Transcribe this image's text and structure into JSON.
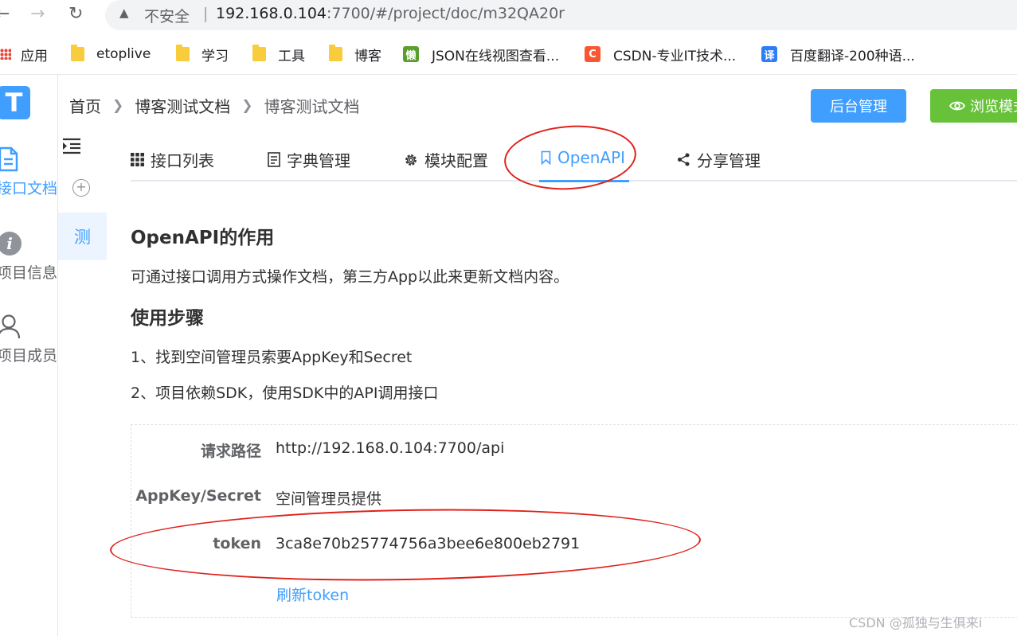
{
  "browser": {
    "security_label": "不安全",
    "url_host": "192.168.0.104",
    "url_rest": ":7700/#/project/doc/m32QA20r",
    "bookmarks": [
      {
        "label": "应用",
        "icon": "apps-grid-icon"
      },
      {
        "label": "etoplive",
        "icon": "folder-icon"
      },
      {
        "label": "学习",
        "icon": "folder-icon"
      },
      {
        "label": "工具",
        "icon": "folder-icon"
      },
      {
        "label": "博客",
        "icon": "folder-icon"
      },
      {
        "label": "JSON在线视图查看...",
        "icon": "lan-icon",
        "glyph": "懒",
        "color": "#5a9e2f"
      },
      {
        "label": "CSDN-专业IT技术...",
        "icon": "csdn-icon",
        "glyph": "C",
        "color": "#fc5531"
      },
      {
        "label": "百度翻译-200种语...",
        "icon": "baidu-translate-icon",
        "glyph": "译",
        "color": "#2d7df6"
      }
    ]
  },
  "sidebar": {
    "logo": "T",
    "items": [
      {
        "label": "接口文档",
        "icon": "document-icon",
        "active": true
      },
      {
        "label": "项目信息",
        "icon": "info-icon",
        "active": false
      },
      {
        "label": "项目成员",
        "icon": "user-icon",
        "active": false
      }
    ]
  },
  "subsidebar": {
    "active_item": "测"
  },
  "header": {
    "breadcrumb": [
      "首页",
      "博客测试文档",
      "博客测试文档"
    ],
    "admin_button": "后台管理",
    "browse_button": "浏览模式"
  },
  "tabs": [
    {
      "label": "接口列表",
      "icon": "grid-icon"
    },
    {
      "label": "字典管理",
      "icon": "dict-icon"
    },
    {
      "label": "模块配置",
      "icon": "gear-icon"
    },
    {
      "label": "OpenAPI",
      "icon": "bookmark-icon",
      "active": true
    },
    {
      "label": "分享管理",
      "icon": "share-icon"
    }
  ],
  "content": {
    "title": "OpenAPI的作用",
    "description": "可通过接口调用方式操作文档，第三方App以此来更新文档内容。",
    "steps_title": "使用步骤",
    "steps": [
      "1、找到空间管理员索要AppKey和Secret",
      "2、项目依赖SDK，使用SDK中的API调用接口"
    ],
    "info_rows": [
      {
        "label": "请求路径",
        "value": "http://192.168.0.104:7700/api"
      },
      {
        "label": "AppKey/Secret",
        "value": "空间管理员提供"
      },
      {
        "label": "token",
        "value": "3ca8e70b25774756a3bee6e800eb2791"
      }
    ],
    "refresh_link": "刷新token"
  },
  "watermark": "CSDN @孤独与生俱来i",
  "colors": {
    "primary": "#409eff",
    "success": "#67c23a",
    "annotation": "#e0211b"
  }
}
